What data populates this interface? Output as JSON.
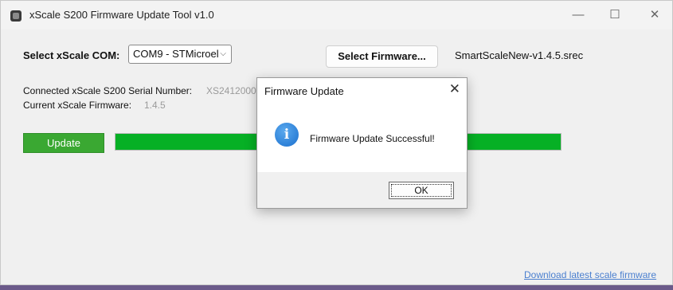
{
  "window": {
    "title": "xScale S200 Firmware Update Tool v1.0",
    "controls": {
      "minimize": "—",
      "maximize": "☐",
      "close": "✕"
    }
  },
  "main": {
    "com_label": "Select xScale COM:",
    "com_selected": "COM9 - STMicroel",
    "select_firmware_label": "Select Firmware...",
    "firmware_filename": "SmartScaleNew-v1.4.5.srec",
    "serial_label": "Connected xScale S200 Serial Number:",
    "serial_value": "XS2412000",
    "firmware_label": "Current xScale Firmware:",
    "firmware_value": "1.4.5",
    "update_button": "Update",
    "progress_percent": 100,
    "download_link": "Download latest scale firmware"
  },
  "dialog": {
    "title": "Firmware Update",
    "message": "Firmware Update Successful!",
    "ok_label": "OK",
    "icon": "info-icon",
    "close_glyph": "✕",
    "info_glyph": "i"
  },
  "colors": {
    "progress_fill": "#06b025",
    "update_button": "#3aa832",
    "link": "#4a7fcf"
  }
}
